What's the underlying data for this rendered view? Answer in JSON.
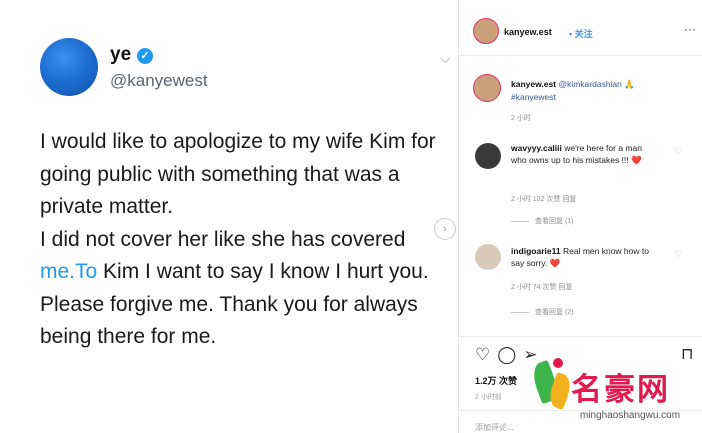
{
  "tweet": {
    "name": "ye",
    "verified_glyph": "✓",
    "handle": "@kanyewest",
    "line1": "I would like to apologize to my wife Kim for going public with something that was a private matter.",
    "line2_pre": "I did not cover her like  she has covered ",
    "line2_link": "me.To",
    "line2_post": " Kim I want to say I know I hurt you. Please forgive me. Thank you for always being there for me."
  },
  "instagram": {
    "username": "kanyew.est",
    "follow": "• 关注",
    "caption_user": "kanyew.est",
    "caption_mention": "@kimkardashian",
    "caption_emoji": "🙏",
    "caption_tag": "#kanyewest",
    "caption_time": "2 小时",
    "comments": [
      {
        "user": "wavyyy.caliii",
        "text": "we're here for a man who owns up to his mistakes !!!",
        "emoji": "❤️",
        "meta": "2 小时   102 次赞   回复",
        "replies": "查看回复 (1)"
      },
      {
        "user": "indigoarie11",
        "text": "Real men know how to say sorry.",
        "emoji": "❤️",
        "meta": "2 小时   74 次赞   回复",
        "replies": "查看回复 (2)"
      }
    ],
    "likes": "1.2万 次赞",
    "post_time": "2 小时前",
    "add_comment": "添加评论..."
  },
  "watermark": {
    "title": "名豪网",
    "sub": "minghaoshangwu.com"
  },
  "colors": {
    "accent": "#1d9bf0",
    "ig_blue": "#3897f0",
    "watermark": "#e01a4f"
  }
}
